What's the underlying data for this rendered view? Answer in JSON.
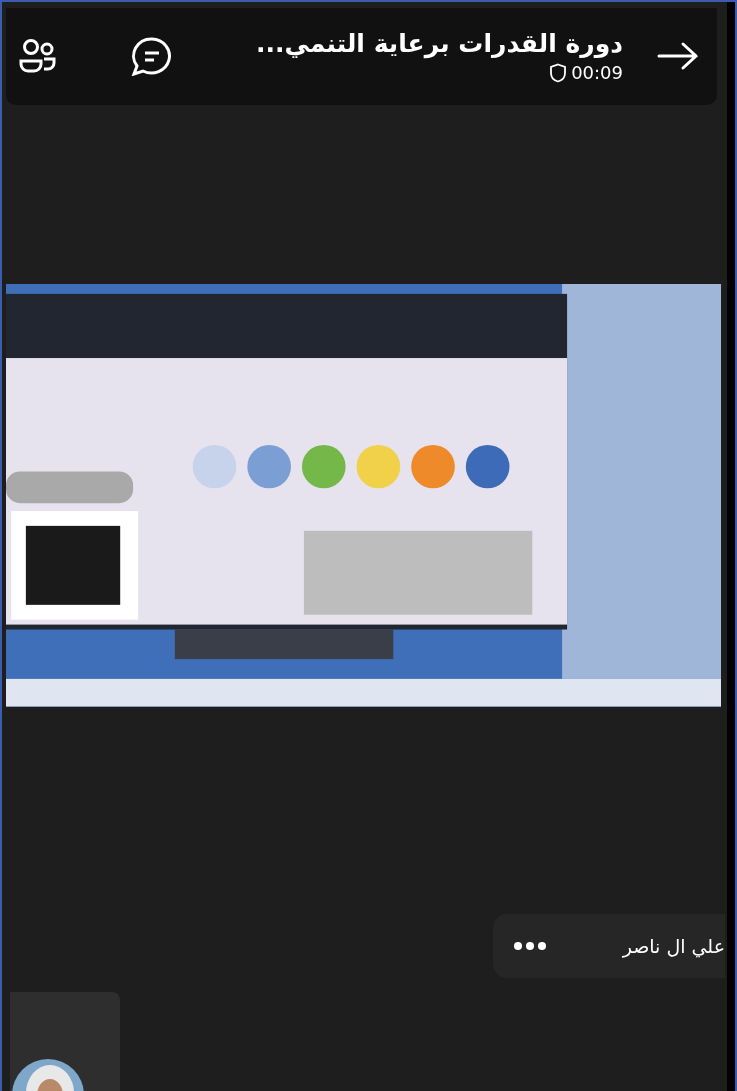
{
  "header": {
    "title": "دورة القدرات برعاية التنمي...",
    "timer": "00:09"
  },
  "participant": {
    "name": "علي ال ناصر"
  }
}
